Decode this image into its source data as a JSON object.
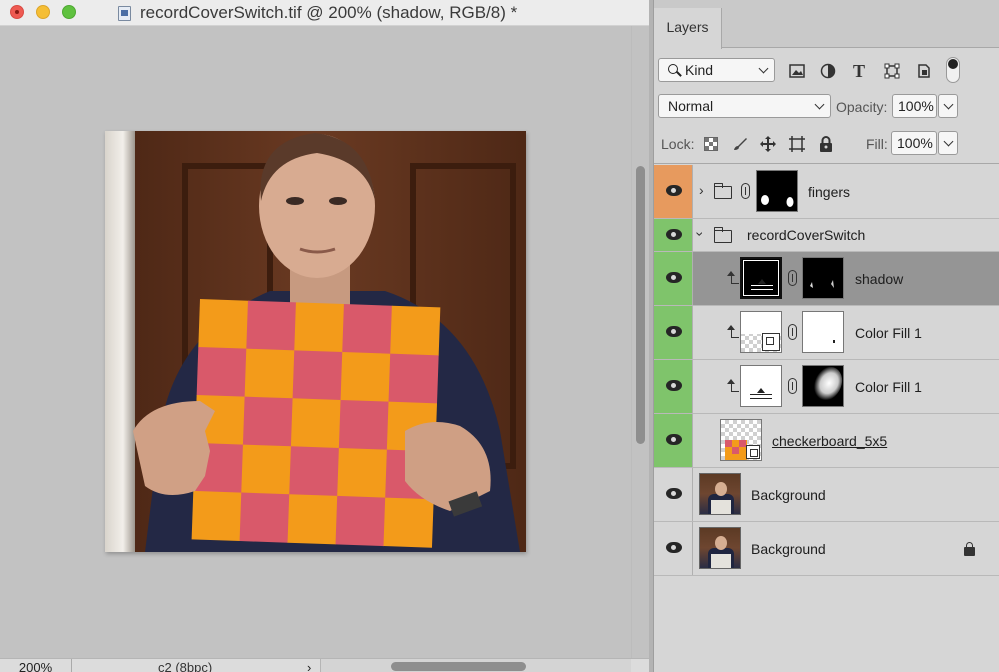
{
  "document": {
    "title": "recordCoverSwitch.tif @ 200% (shadow, RGB/8) *",
    "zoom": "200%",
    "info": "c2 (8bpc)",
    "status_arrow": "›"
  },
  "layers_panel": {
    "tab_label": "Layers",
    "filter_kind": "Kind",
    "blend_mode": "Normal",
    "opacity_label": "Opacity:",
    "opacity_value": "100%",
    "lock_label": "Lock:",
    "fill_label": "Fill:",
    "fill_value": "100%",
    "layers": [
      {
        "name": "fingers",
        "type": "group",
        "expanded": false,
        "eye_color": "#e79a5e"
      },
      {
        "name": "recordCoverSwitch",
        "type": "group",
        "expanded": true,
        "eye_color": "#7fc46b"
      },
      {
        "name": "shadow",
        "type": "adjustment",
        "clipped": true,
        "selected": true,
        "eye_color": "#7fc46b"
      },
      {
        "name": "Color Fill 1",
        "type": "fill",
        "clipped": true,
        "eye_color": "#7fc46b"
      },
      {
        "name": "Color Fill 1",
        "type": "fill",
        "clipped": true,
        "eye_color": "#7fc46b"
      },
      {
        "name": "checkerboard_5x5",
        "type": "smart-object",
        "eye_color": "#7fc46b"
      },
      {
        "name": "Background",
        "type": "pixel",
        "eye_color": "#d6d6d6"
      },
      {
        "name": "Background",
        "type": "pixel",
        "locked": true,
        "eye_color": "#d6d6d6"
      }
    ]
  },
  "colors": {
    "checker_orange": "#f39b1a",
    "checker_pink": "#d9596a",
    "group_orange": "#e79a5e",
    "group_green": "#7fc46b"
  }
}
